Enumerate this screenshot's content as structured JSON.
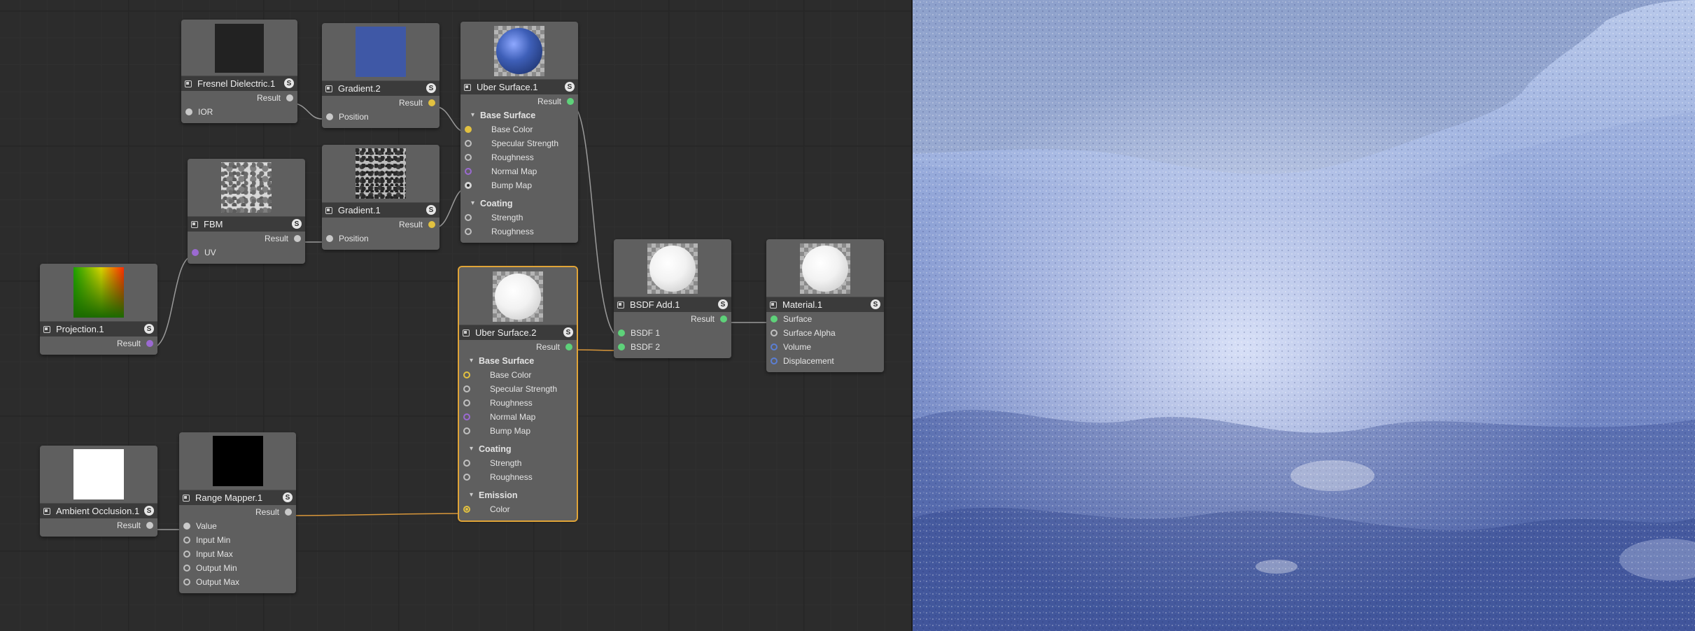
{
  "nodes": {
    "fresnel": {
      "title": "Fresnel Dielectric.1",
      "outputs": [
        "Result"
      ],
      "inputs": [
        "IOR"
      ]
    },
    "gradient2": {
      "title": "Gradient.2",
      "outputs": [
        "Result"
      ],
      "inputs": [
        "Position"
      ]
    },
    "uber1": {
      "title": "Uber Surface.1",
      "output": "Result",
      "group1": "Base Surface",
      "base_inputs": [
        "Base Color",
        "Specular Strength",
        "Roughness",
        "Normal Map",
        "Bump Map"
      ],
      "group2": "Coating",
      "coating_inputs": [
        "Strength",
        "Roughness"
      ]
    },
    "fbm": {
      "title": "FBM",
      "outputs": [
        "Result"
      ],
      "inputs": [
        "UV"
      ]
    },
    "gradient1": {
      "title": "Gradient.1",
      "outputs": [
        "Result"
      ],
      "inputs": [
        "Position"
      ]
    },
    "projection": {
      "title": "Projection.1",
      "outputs": [
        "Result"
      ]
    },
    "uber2": {
      "title": "Uber Surface.2",
      "output": "Result",
      "group1": "Base Surface",
      "base_inputs": [
        "Base Color",
        "Specular Strength",
        "Roughness",
        "Normal Map",
        "Bump Map"
      ],
      "group2": "Coating",
      "coating_inputs": [
        "Strength",
        "Roughness"
      ],
      "group3": "Emission",
      "emission_inputs": [
        "Color"
      ]
    },
    "bsdf_add": {
      "title": "BSDF Add.1",
      "outputs": [
        "Result"
      ],
      "inputs": [
        "BSDF 1",
        "BSDF 2"
      ]
    },
    "material": {
      "title": "Material.1",
      "inputs": [
        "Surface",
        "Surface Alpha",
        "Volume",
        "Displacement"
      ]
    },
    "ambient": {
      "title": "Ambient Occlusion.1",
      "outputs": [
        "Result"
      ]
    },
    "range_mapper": {
      "title": "Range Mapper.1",
      "outputs": [
        "Result"
      ],
      "inputs": [
        "Value",
        "Input Min",
        "Input Max",
        "Output Min",
        "Output Max"
      ]
    }
  },
  "badge_label": "S",
  "colors": {
    "wire_gray": "#9a9a9a",
    "wire_orange": "#d9973a",
    "selected_outline": "#e0a437",
    "port_yellow": "#e2c140",
    "port_purple": "#9b6ad2",
    "port_green": "#5ed27a",
    "port_blue": "#5b7fd4"
  },
  "icons": {
    "node_type": "node-icon",
    "solo": "solo-badge-icon"
  }
}
